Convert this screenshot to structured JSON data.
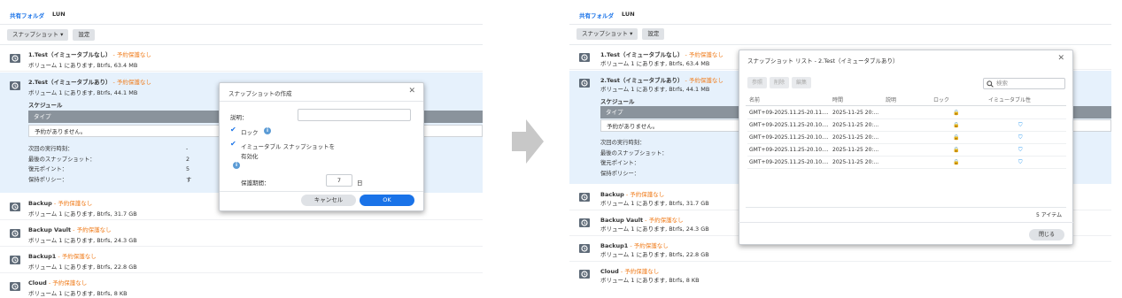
{
  "left": {
    "tabs": [
      "共有フォルダ",
      "LUN"
    ],
    "toolbar": {
      "snapshot_label": "スナップショット ▾",
      "settings_label": "設定"
    },
    "folders": [
      {
        "name": "1.Test（イミュータブルなし）",
        "status": " - 予約保護なし",
        "desc": "ボリューム 1 にあります, Btrfs, 63.4 MB"
      },
      {
        "name": "2.Test（イミュータブルあり）",
        "status": " - 予約保護なし",
        "desc": "ボリューム 1 にあります, Btrfs, 44.1 MB"
      },
      {
        "name": "Backup",
        "status": " - 予約保護なし",
        "desc": "ボリューム 1 にあります, Btrfs, 31.7 GB"
      },
      {
        "name": "Backup Vault",
        "status": " - 予約保護なし",
        "desc": "ボリューム 1 にあります, Btrfs, 24.3 GB"
      },
      {
        "name": "Backup1",
        "status": " - 予約保護なし",
        "desc": "ボリューム 1 にあります, Btrfs, 22.8 GB"
      },
      {
        "name": "Cloud",
        "status": " - 予約保護なし",
        "desc": "ボリューム 1 にあります, Btrfs, 8 KB"
      }
    ],
    "schedule": {
      "title": "スケジュール",
      "type_header": "タイプ",
      "none": "予約がありません。",
      "info_labels": [
        "次回の実行時刻：",
        "最後のスナップショット：",
        "復元ポイント：",
        "保持ポリシー："
      ],
      "info_values": [
        "-",
        "2",
        "5",
        "す"
      ]
    },
    "dialog": {
      "title": "スナップショットの作成",
      "desc_label": "説明：",
      "lock_label": "ロック",
      "immutable_label_1": "イミュータブル スナップショットを",
      "immutable_label_2": "有効化",
      "retention_label": "保護期間：",
      "retention_value": "7",
      "retention_unit": "日",
      "cancel_label": "キャンセル",
      "ok_label": "OK"
    }
  },
  "right": {
    "tabs": [
      "共有フォルダ",
      "LUN"
    ],
    "toolbar": {
      "snapshot_label": "スナップショット ▾",
      "settings_label": "設定"
    },
    "folders": [
      {
        "name": "1.Test（イミュータブルなし）",
        "status": " - 予約保護なし",
        "desc": "ボリューム 1 にあります, Btrfs, 63.4 MB"
      },
      {
        "name": "2.Test（イミュータブルあり）",
        "status": " - 予約保護なし",
        "desc": "ボリューム 1 にあります, Btrfs, 44.1 MB"
      },
      {
        "name": "Backup",
        "status": " - 予約保護なし",
        "desc": "ボリューム 1 にあります, Btrfs, 31.7 GB"
      },
      {
        "name": "Backup Vault",
        "status": " - 予約保護なし",
        "desc": "ボリューム 1 にあります, Btrfs, 24.3 GB"
      },
      {
        "name": "Backup1",
        "status": " - 予約保護なし",
        "desc": "ボリューム 1 にあります, Btrfs, 22.8 GB"
      },
      {
        "name": "Cloud",
        "status": " - 予約保護なし",
        "desc": "ボリューム 1 にあります, Btrfs, 8 KB"
      }
    ],
    "schedule": {
      "title": "スケジュール",
      "type_header": "タイプ",
      "none": "予約がありません。",
      "info_labels": [
        "次回の実行時刻：",
        "最後のスナップショット：",
        "復元ポイント：",
        "保持ポリシー："
      ]
    },
    "snapshot_list": {
      "title": "スナップショット リスト - 2.Test（イミュータブルあり）",
      "buttons": [
        "参照",
        "削除",
        "編集"
      ],
      "search_placeholder": "検索",
      "columns": [
        "名前",
        "時間",
        "説明",
        "ロック",
        "イミュータブル性"
      ],
      "rows": [
        {
          "name": "GMT+09-2025.11.25-20.11....",
          "time": "2025-11-25 20:...",
          "immutable": false
        },
        {
          "name": "GMT+09-2025.11.25-20.10....",
          "time": "2025-11-25 20:...",
          "immutable": true
        },
        {
          "name": "GMT+09-2025.11.25-20.10....",
          "time": "2025-11-25 20:...",
          "immutable": true
        },
        {
          "name": "GMT+09-2025.11.25-20.10....",
          "time": "2025-11-25 20:...",
          "immutable": true
        },
        {
          "name": "GMT+09-2025.11.25-20.10....",
          "time": "2025-11-25 20:...",
          "immutable": true
        }
      ],
      "count": "5 アイテム",
      "close_label": "閉じる"
    }
  },
  "colors": {
    "accent": "#1a73e8",
    "warning": "#f07c1b",
    "selected_row": "#e6f1fc",
    "lock": "#f5a623",
    "shield": "#2f9bf0"
  }
}
